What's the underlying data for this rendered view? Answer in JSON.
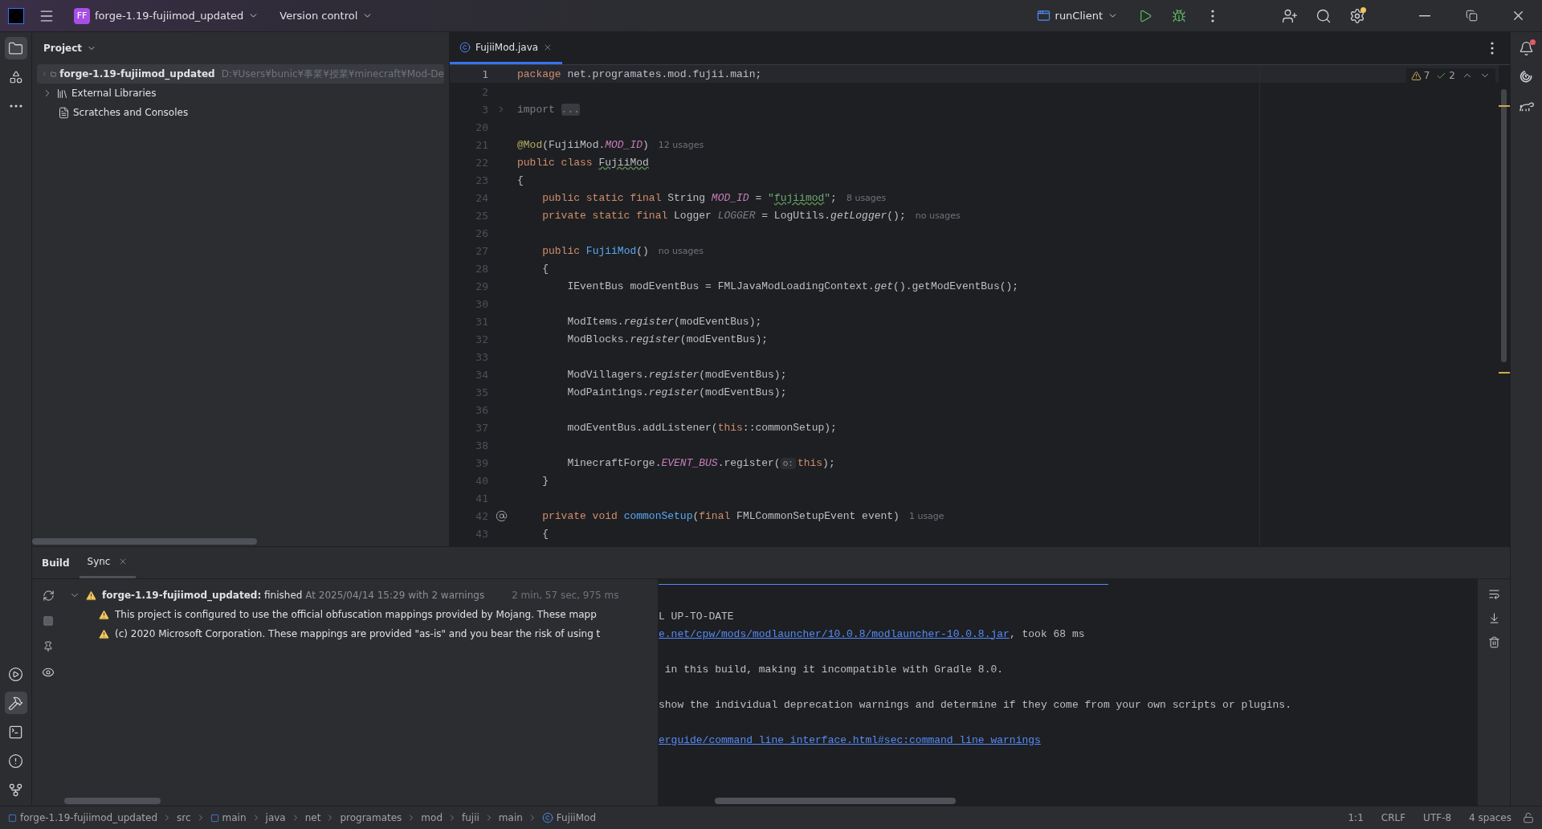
{
  "title_bar": {
    "badge": "FF",
    "project": "forge-1.19-fujiimod_updated",
    "vcs": "Version control",
    "run_config": "runClient"
  },
  "project_panel": {
    "title": "Project",
    "tree": [
      {
        "label": "forge-1.19-fujiimod_updated",
        "path": "D:¥Users¥bunic¥事業¥授業¥minecraft¥Mod-De",
        "kind": "module",
        "expanded": false,
        "selected": true
      },
      {
        "label": "External Libraries",
        "kind": "library",
        "expanded": false,
        "selected": false
      },
      {
        "label": "Scratches and Consoles",
        "kind": "scratches",
        "selected": false
      }
    ]
  },
  "editor": {
    "tabs": [
      {
        "label": "FujiiMod.java",
        "selected": true
      }
    ],
    "inspections": {
      "warnings": "7",
      "weak_warnings": "2"
    },
    "lines": [
      {
        "no": "1",
        "current": true,
        "code": [
          {
            "kind": "kw",
            "text": "package"
          },
          {
            "kind": "plain",
            "text": " net.programates.mod.fujii.main;"
          }
        ]
      },
      {
        "no": "2",
        "current": false
      },
      {
        "no": "3",
        "current": false,
        "kind": "folded",
        "code": [
          {
            "kind": "dim",
            "text": "import "
          },
          {
            "kind": "folded",
            "text": "..."
          }
        ]
      },
      {
        "no": "20",
        "current": false
      },
      {
        "no": "21",
        "current": false,
        "code": [
          {
            "kind": "annotation",
            "text": "@Mod"
          },
          {
            "kind": "plain",
            "text": "(FujiiMod."
          },
          {
            "kind": "field",
            "text": "MOD_ID"
          },
          {
            "kind": "plain",
            "text": ")"
          }
        ],
        "hint": "12 usages"
      },
      {
        "no": "22",
        "current": false,
        "code": [
          {
            "kind": "kw",
            "text": "public class "
          },
          {
            "kind": "typo",
            "text": "FujiiMod"
          }
        ]
      },
      {
        "no": "23",
        "current": false,
        "code": [
          {
            "kind": "plain",
            "text": "{"
          }
        ]
      },
      {
        "no": "24",
        "current": false,
        "code": [
          {
            "kind": "kw",
            "text": "    public static final "
          },
          {
            "kind": "plain",
            "text": "String "
          },
          {
            "kind": "field",
            "text": "MOD_ID"
          },
          {
            "kind": "plain",
            "text": " = "
          },
          {
            "kind": "string",
            "text": "\""
          },
          {
            "kind": "string-typo",
            "text": "fujiimod"
          },
          {
            "kind": "string",
            "text": "\""
          },
          {
            "kind": "plain",
            "text": ";"
          }
        ],
        "hint": "8 usages"
      },
      {
        "no": "25",
        "current": false,
        "code": [
          {
            "kind": "kw",
            "text": "    private static final "
          },
          {
            "kind": "plain",
            "text": "Logger "
          },
          {
            "kind": "unused",
            "text": "LOGGER"
          },
          {
            "kind": "plain",
            "text": " = LogUtils."
          },
          {
            "kind": "static",
            "text": "getLogger"
          },
          {
            "kind": "plain",
            "text": "();"
          }
        ],
        "hint": "no usages"
      },
      {
        "no": "26",
        "current": false
      },
      {
        "no": "27",
        "current": false,
        "code": [
          {
            "kind": "kw",
            "text": "    public "
          },
          {
            "kind": "decl",
            "text": "FujiiMod"
          },
          {
            "kind": "plain",
            "text": "()"
          }
        ],
        "hint": "no usages"
      },
      {
        "no": "28",
        "current": false,
        "code": [
          {
            "kind": "plain",
            "text": "    {"
          }
        ]
      },
      {
        "no": "29",
        "current": false,
        "code": [
          {
            "kind": "plain",
            "text": "        IEventBus modEventBus = FMLJavaModLoadingContext."
          },
          {
            "kind": "static",
            "text": "get"
          },
          {
            "kind": "plain",
            "text": "().getModEventBus();"
          }
        ]
      },
      {
        "no": "30",
        "current": false
      },
      {
        "no": "31",
        "current": false,
        "code": [
          {
            "kind": "plain",
            "text": "        ModItems."
          },
          {
            "kind": "static",
            "text": "register"
          },
          {
            "kind": "plain",
            "text": "(modEventBus);"
          }
        ]
      },
      {
        "no": "32",
        "current": false,
        "code": [
          {
            "kind": "plain",
            "text": "        ModBlocks."
          },
          {
            "kind": "static",
            "text": "register"
          },
          {
            "kind": "plain",
            "text": "(modEventBus);"
          }
        ]
      },
      {
        "no": "33",
        "current": false
      },
      {
        "no": "34",
        "current": false,
        "code": [
          {
            "kind": "plain",
            "text": "        ModVillagers."
          },
          {
            "kind": "static",
            "text": "register"
          },
          {
            "kind": "plain",
            "text": "(modEventBus);"
          }
        ]
      },
      {
        "no": "35",
        "current": false,
        "code": [
          {
            "kind": "plain",
            "text": "        ModPaintings."
          },
          {
            "kind": "static",
            "text": "register"
          },
          {
            "kind": "plain",
            "text": "(modEventBus);"
          }
        ]
      },
      {
        "no": "36",
        "current": false
      },
      {
        "no": "37",
        "current": false,
        "code": [
          {
            "kind": "plain",
            "text": "        modEventBus.addListener("
          },
          {
            "kind": "kw",
            "text": "this"
          },
          {
            "kind": "plain",
            "text": "::commonSetup);"
          }
        ]
      },
      {
        "no": "38",
        "current": false
      },
      {
        "no": "39",
        "current": false,
        "code": [
          {
            "kind": "plain",
            "text": "        MinecraftForge."
          },
          {
            "kind": "field",
            "text": "EVENT_BUS"
          },
          {
            "kind": "plain",
            "text": ".register("
          },
          {
            "kind": "inlay",
            "text": "o:"
          },
          {
            "kind": "kw",
            "text": "this"
          },
          {
            "kind": "plain",
            "text": ");"
          }
        ]
      },
      {
        "no": "40",
        "current": false,
        "code": [
          {
            "kind": "plain",
            "text": "    }"
          }
        ]
      },
      {
        "no": "41",
        "current": false
      },
      {
        "no": "42",
        "current": false,
        "kind": "implementing",
        "code": [
          {
            "kind": "kw",
            "text": "    private void "
          },
          {
            "kind": "decl",
            "text": "commonSetup"
          },
          {
            "kind": "plain",
            "text": "("
          },
          {
            "kind": "kw",
            "text": "final "
          },
          {
            "kind": "plain",
            "text": "FMLCommonSetupEvent event)"
          }
        ],
        "hint": "1 usage"
      },
      {
        "no": "43",
        "current": false,
        "code": [
          {
            "kind": "plain",
            "text": "    {"
          }
        ]
      }
    ]
  },
  "bottom_panel": {
    "title": "Build",
    "tabs": [
      {
        "label": "Sync",
        "selected": true
      }
    ],
    "build_tree": {
      "name": "forge-1.19-fujiimod_updated:",
      "status": "finished",
      "detail": "At 2025/04/14 15:29 with 2 warnings",
      "duration": "2 min, 57 sec, 975 ms",
      "expanded": true,
      "children": [
        {
          "kind": "warning",
          "text": "This project is configured to use the official obfuscation mappings provided by Mojang. These mapp"
        },
        {
          "kind": "warning",
          "text": "(c) 2020 Microsoft Corporation. These mappings are provided \"as-is\" and you bear the risk of using t"
        }
      ]
    },
    "console": [
      {
        "kind": "text",
        "segments": [
          {
            "text": "L UP-TO-DATE",
            "link": false
          }
        ]
      },
      {
        "kind": "text",
        "segments": [
          {
            "text": "e.net/cpw/mods/modlauncher/10.0.8/modlauncher-10.0.8.jar",
            "link": true
          },
          {
            "text": ", took 68 ms",
            "link": false
          }
        ]
      },
      {
        "kind": "blank"
      },
      {
        "kind": "text",
        "segments": [
          {
            "text": " in this build, making it incompatible with Gradle 8.0.",
            "link": false
          }
        ]
      },
      {
        "kind": "blank"
      },
      {
        "kind": "text",
        "segments": [
          {
            "text": "show the individual deprecation warnings and determine if they come from your own scripts or plugins.",
            "link": false
          }
        ]
      },
      {
        "kind": "blank"
      },
      {
        "kind": "text",
        "segments": [
          {
            "text": "erguide/command_line_interface.html#sec:command_line_warnings",
            "link": true
          }
        ]
      }
    ]
  },
  "status_bar": {
    "breadcrumbs": [
      {
        "label": "forge-1.19-fujiimod_updated",
        "kind": "module"
      },
      {
        "label": "src",
        "kind": "folder"
      },
      {
        "label": "main",
        "kind": "module"
      },
      {
        "label": "java",
        "kind": "folder"
      },
      {
        "label": "net",
        "kind": "folder"
      },
      {
        "label": "programates",
        "kind": "folder"
      },
      {
        "label": "mod",
        "kind": "folder"
      },
      {
        "label": "fujii",
        "kind": "folder"
      },
      {
        "label": "main",
        "kind": "folder"
      },
      {
        "label": "FujiiMod",
        "kind": "class"
      }
    ],
    "position": "1:1",
    "line_ending": "CRLF",
    "encoding": "UTF-8",
    "indent": "4 spaces"
  }
}
